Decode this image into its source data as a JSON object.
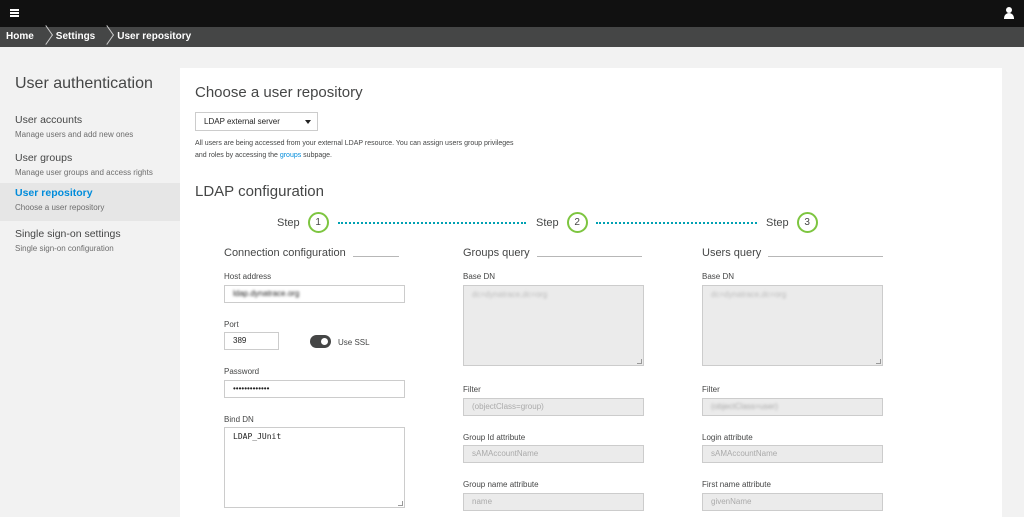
{
  "breadcrumb": [
    "Home",
    "Settings",
    "User repository"
  ],
  "sidebar": {
    "title": "User authentication",
    "items": [
      {
        "label": "User accounts",
        "sub": "Manage users and add new ones"
      },
      {
        "label": "User groups",
        "sub": "Manage user groups and access rights"
      },
      {
        "label": "User repository",
        "sub": "Choose a user repository"
      },
      {
        "label": "Single sign-on settings",
        "sub": "Single sign-on configuration"
      }
    ]
  },
  "main": {
    "heading": "Choose a user repository",
    "select_value": "LDAP external server",
    "description_pre": "All users are being accessed from your external LDAP resource. You can assign users group privileges and roles by accessing the ",
    "description_link": "groups",
    "description_post": " subpage.",
    "ldap_heading": "LDAP configuration",
    "steps": [
      {
        "label": "Step",
        "num": "1"
      },
      {
        "label": "Step",
        "num": "2"
      },
      {
        "label": "Step",
        "num": "3"
      }
    ]
  },
  "connection": {
    "title": "Connection configuration",
    "host_label": "Host address",
    "host_value": "ldap.dynatrace.org",
    "port_label": "Port",
    "port_value": "389",
    "ssl_label": "Use SSL",
    "password_label": "Password",
    "password_value": "•••••••••••••",
    "binddn_label": "Bind DN",
    "binddn_value": "LDAP_JUnit"
  },
  "groups": {
    "title": "Groups query",
    "basedn_label": "Base DN",
    "basedn_placeholder": "dc=dynatrace,dc=org",
    "filter_label": "Filter",
    "filter_placeholder": "(objectClass=group)",
    "groupid_label": "Group Id attribute",
    "groupid_placeholder": "sAMAccountName",
    "groupname_label": "Group name attribute",
    "groupname_placeholder": "name"
  },
  "users": {
    "title": "Users query",
    "basedn_label": "Base DN",
    "basedn_placeholder": "dc=dynatrace,dc=org",
    "filter_label": "Filter",
    "filter_placeholder": "(objectClass=user)",
    "login_label": "Login attribute",
    "login_placeholder": "sAMAccountName",
    "firstname_label": "First name attribute",
    "firstname_placeholder": "givenName"
  }
}
